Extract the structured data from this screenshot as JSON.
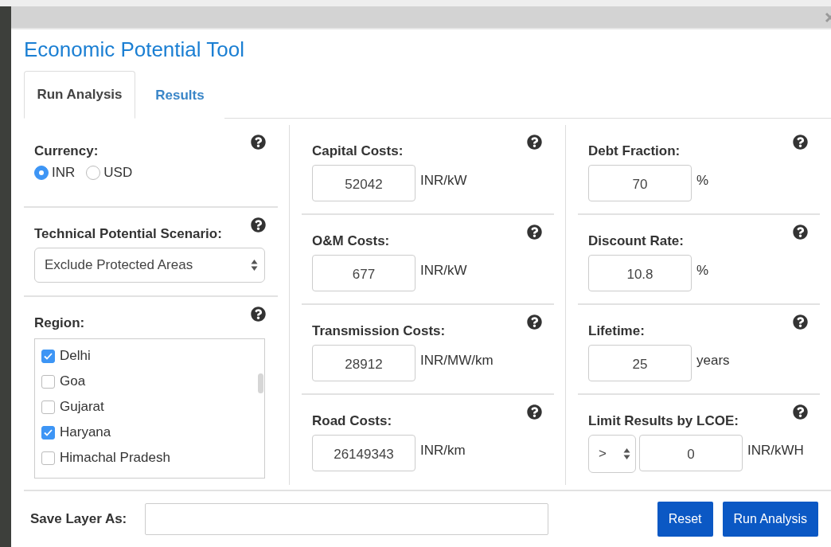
{
  "window": {
    "title": "Economic Potential Tool"
  },
  "tabs": [
    {
      "label": "Run Analysis",
      "selected": true
    },
    {
      "label": "Results",
      "selected": false
    }
  ],
  "currency": {
    "label": "Currency:",
    "options": [
      {
        "label": "INR",
        "selected": true
      },
      {
        "label": "USD",
        "selected": false
      }
    ]
  },
  "scenario": {
    "label": "Technical Potential Scenario:",
    "value": "Exclude Protected Areas"
  },
  "region": {
    "label": "Region:",
    "items": [
      {
        "label": "Delhi",
        "checked": true
      },
      {
        "label": "Goa",
        "checked": false
      },
      {
        "label": "Gujarat",
        "checked": false
      },
      {
        "label": "Haryana",
        "checked": true
      },
      {
        "label": "Himachal Pradesh",
        "checked": false
      }
    ]
  },
  "costs": [
    {
      "kind": "number",
      "label": "Capital Costs:",
      "value": "52042",
      "unit": "INR/kW"
    },
    {
      "kind": "number",
      "label": "O&M Costs:",
      "value": "677",
      "unit": "INR/kW"
    },
    {
      "kind": "number",
      "label": "Transmission Costs:",
      "value": "28912",
      "unit": "INR/MW/km"
    },
    {
      "kind": "number",
      "label": "Road Costs:",
      "value": "26149343",
      "unit": "INR/km"
    }
  ],
  "finance": [
    {
      "kind": "number",
      "label": "Debt Fraction:",
      "value": "70",
      "unit": "%"
    },
    {
      "kind": "number",
      "label": "Discount Rate:",
      "value": "10.8",
      "unit": "%"
    },
    {
      "kind": "number",
      "label": "Lifetime:",
      "value": "25",
      "unit": "years"
    },
    {
      "kind": "limit",
      "label": "Limit Results by LCOE:",
      "operator": ">",
      "value": "0",
      "unit": "INR/kWH"
    }
  ],
  "save": {
    "label": "Save Layer As:"
  },
  "buttons": [
    "Reset",
    "Run Analysis"
  ]
}
